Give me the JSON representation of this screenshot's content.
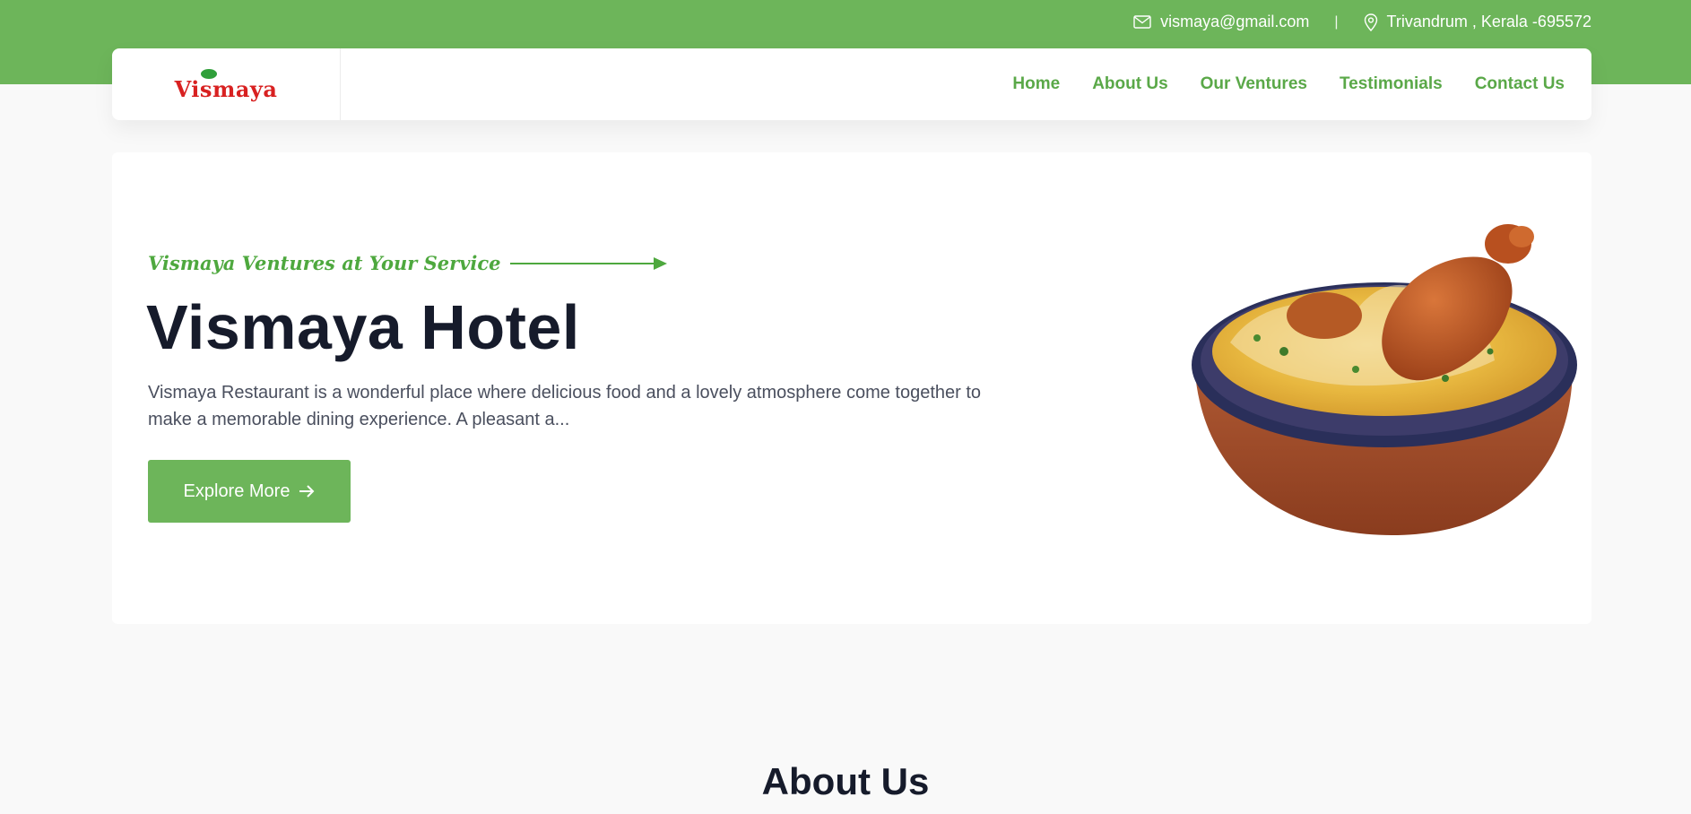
{
  "topbar": {
    "email": "vismaya@gmail.com",
    "separator": "|",
    "location": "Trivandrum , Kerala -695572",
    "email_icon": "envelope-icon",
    "location_icon": "map-pin-icon"
  },
  "brand": {
    "logo_text": "Vismaya"
  },
  "nav": {
    "items": [
      {
        "label": "Home"
      },
      {
        "label": "About Us"
      },
      {
        "label": "Our Ventures"
      },
      {
        "label": "Testimonials"
      },
      {
        "label": "Contact Us"
      }
    ]
  },
  "hero": {
    "tagline": "Vismaya Ventures at Your Service",
    "title": "Vismaya Hotel",
    "description": "Vismaya Restaurant is a wonderful place where delicious food and a lovely atmosphere come together to make a memorable dining experience. A pleasant a...",
    "button_label": "Explore More",
    "button_icon": "arrow-right-icon"
  },
  "about": {
    "heading": "About Us"
  },
  "colors": {
    "brand_green": "#6db55a",
    "nav_green": "#5aa848",
    "heading_dark": "#161b2b",
    "logo_red": "#d82121"
  }
}
